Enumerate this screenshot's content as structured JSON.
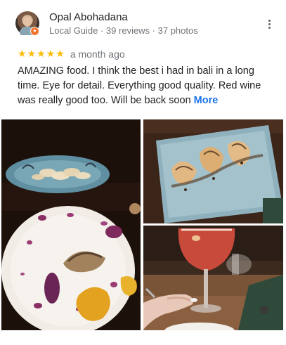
{
  "reviewer": {
    "name": "Opal Abohadana",
    "meta": "Local Guide · 39 reviews · 37 photos",
    "badge_icon": "local-guide-star-icon",
    "avatar_icon": "avatar"
  },
  "review": {
    "stars": 5,
    "star_glyph": "★",
    "date": "a month ago",
    "text": "AMAZING food. I think the best i had in bali in a long time. Eye for detail. Everything good quality. Red wine was really good too. Will be back soon",
    "more_label": "More"
  },
  "menu_icon": "more-vert-icon",
  "photos": [
    {
      "name": "dumplings-and-plate-photo"
    },
    {
      "name": "dumplings-on-blue-plate-photo"
    },
    {
      "name": "red-wine-glass-photo"
    }
  ],
  "colors": {
    "star": "#fbbc04",
    "link": "#1a73e8",
    "meta_text": "#70757a",
    "badge": "#f4722b"
  }
}
